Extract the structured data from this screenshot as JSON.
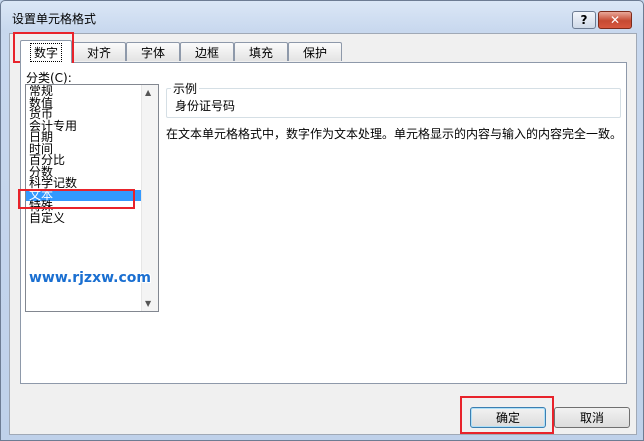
{
  "window": {
    "title": "设置单元格格式",
    "help_label": "?",
    "close_label": "✕"
  },
  "tabs": [
    {
      "label": "数字",
      "active": true
    },
    {
      "label": "对齐",
      "active": false
    },
    {
      "label": "字体",
      "active": false
    },
    {
      "label": "边框",
      "active": false
    },
    {
      "label": "填充",
      "active": false
    },
    {
      "label": "保护",
      "active": false
    }
  ],
  "category": {
    "label": "分类(C):",
    "items": [
      "常规",
      "数值",
      "货币",
      "会计专用",
      "日期",
      "时间",
      "百分比",
      "分数",
      "科学记数",
      "文本",
      "特殊",
      "自定义"
    ],
    "selected": "文本",
    "scroll_up_icon": "scroll-up-arrow",
    "scroll_down_icon": "scroll-down-arrow"
  },
  "sample": {
    "legend": "示例",
    "value": "身份证号码"
  },
  "description": "在文本单元格格式中，数字作为文本处理。单元格显示的内容与输入的内容完全一致。",
  "watermark": "www.rjzxw.com",
  "buttons": {
    "ok": "确定",
    "cancel": "取消"
  },
  "colors": {
    "selection": "#3399ff",
    "highlight": "#e8232b",
    "watermark": "#1a6fd1"
  }
}
